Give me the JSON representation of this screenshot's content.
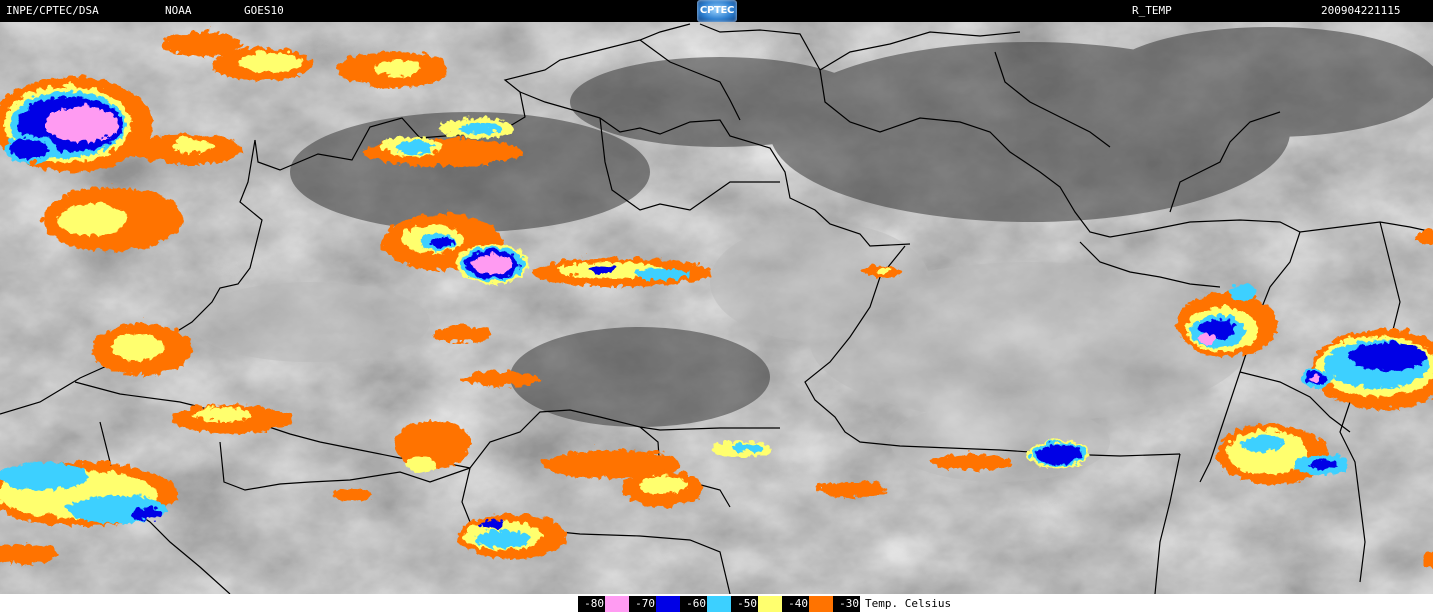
{
  "header": {
    "organization": "INPE/CPTEC/DSA",
    "satellite_agency": "NOAA",
    "satellite": "GOES10",
    "logo_text": "CPTEC",
    "product": "R_TEMP",
    "timestamp": "200904221115"
  },
  "legend": {
    "unit_label": "Temp. Celsius",
    "bins": [
      {
        "label": "-80",
        "color": "#ff9bf2"
      },
      {
        "label": "-70",
        "color": "#0000e6"
      },
      {
        "label": "-60",
        "color": "#3cd0ff"
      },
      {
        "label": "-50",
        "color": "#ffff6e"
      },
      {
        "label": "-40",
        "color": "#ff7300"
      },
      {
        "label": "-30",
        "color": null
      }
    ]
  },
  "colors": {
    "cloud_minus80": "#ff9bf2",
    "cloud_minus70": "#0000e6",
    "cloud_minus60": "#3cd0ff",
    "cloud_minus50": "#ffff6e",
    "cloud_minus40": "#ff7300",
    "background_header": "#000000",
    "borders": "#000000"
  }
}
